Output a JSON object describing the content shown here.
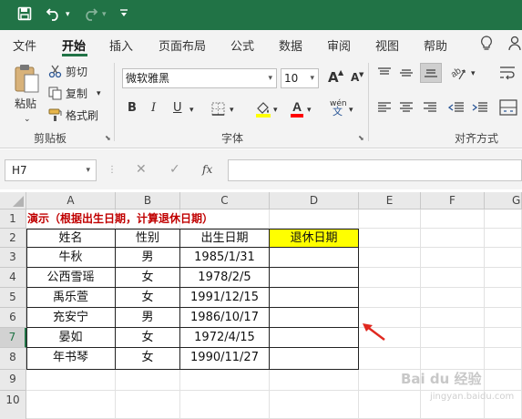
{
  "titlebar": {
    "save_icon": "save-icon",
    "undo_icon": "undo-icon",
    "redo_icon": "redo-icon",
    "customize_icon": "customize-quick-access-icon"
  },
  "tabs": [
    {
      "label": "文件"
    },
    {
      "label": "开始"
    },
    {
      "label": "插入"
    },
    {
      "label": "页面布局"
    },
    {
      "label": "公式"
    },
    {
      "label": "数据"
    },
    {
      "label": "审阅"
    },
    {
      "label": "视图"
    },
    {
      "label": "帮助"
    }
  ],
  "ribbon": {
    "clipboard": {
      "paste": "粘贴",
      "cut": "剪切",
      "copy": "复制",
      "format_painter": "格式刷",
      "group_label": "剪贴板"
    },
    "font": {
      "font_name": "微软雅黑",
      "font_size": "10",
      "bold": "B",
      "italic": "I",
      "underline": "U",
      "font_color": "A",
      "wen": "wén",
      "wen_char": "文",
      "grow_font": "A",
      "shrink_font": "A",
      "group_label": "字体"
    },
    "alignment": {
      "group_label": "对齐方式"
    }
  },
  "formula_bar": {
    "name_box": "H7",
    "fx": "fx",
    "cancel": "✕",
    "enter": "✓",
    "formula": ""
  },
  "sheet": {
    "columns": [
      "A",
      "B",
      "C",
      "D",
      "E",
      "F",
      "G"
    ],
    "rows": [
      "1",
      "2",
      "3",
      "4",
      "5",
      "6",
      "7",
      "8",
      "9",
      "10"
    ],
    "title": "演示（根据出生日期，计算退休日期）",
    "headers": [
      "姓名",
      "性别",
      "出生日期",
      "退休日期"
    ],
    "records": [
      [
        "牛秋",
        "男",
        "1985/1/31",
        ""
      ],
      [
        "公西雪瑶",
        "女",
        "1978/2/5",
        ""
      ],
      [
        "禹乐萱",
        "女",
        "1991/12/15",
        ""
      ],
      [
        "充安宁",
        "男",
        "1986/10/17",
        ""
      ],
      [
        "晏如",
        "女",
        "1972/4/15",
        ""
      ],
      [
        "年书琴",
        "女",
        "1990/11/27",
        ""
      ]
    ],
    "selected_cell": "H7"
  },
  "colors": {
    "brand": "#217346",
    "title_red": "#c00000",
    "highlight_yellow": "#ffff00",
    "arrow_red": "#e0281f"
  },
  "watermark": {
    "text": "Bai du 经验",
    "sub": "jingyan.baidu.com"
  }
}
